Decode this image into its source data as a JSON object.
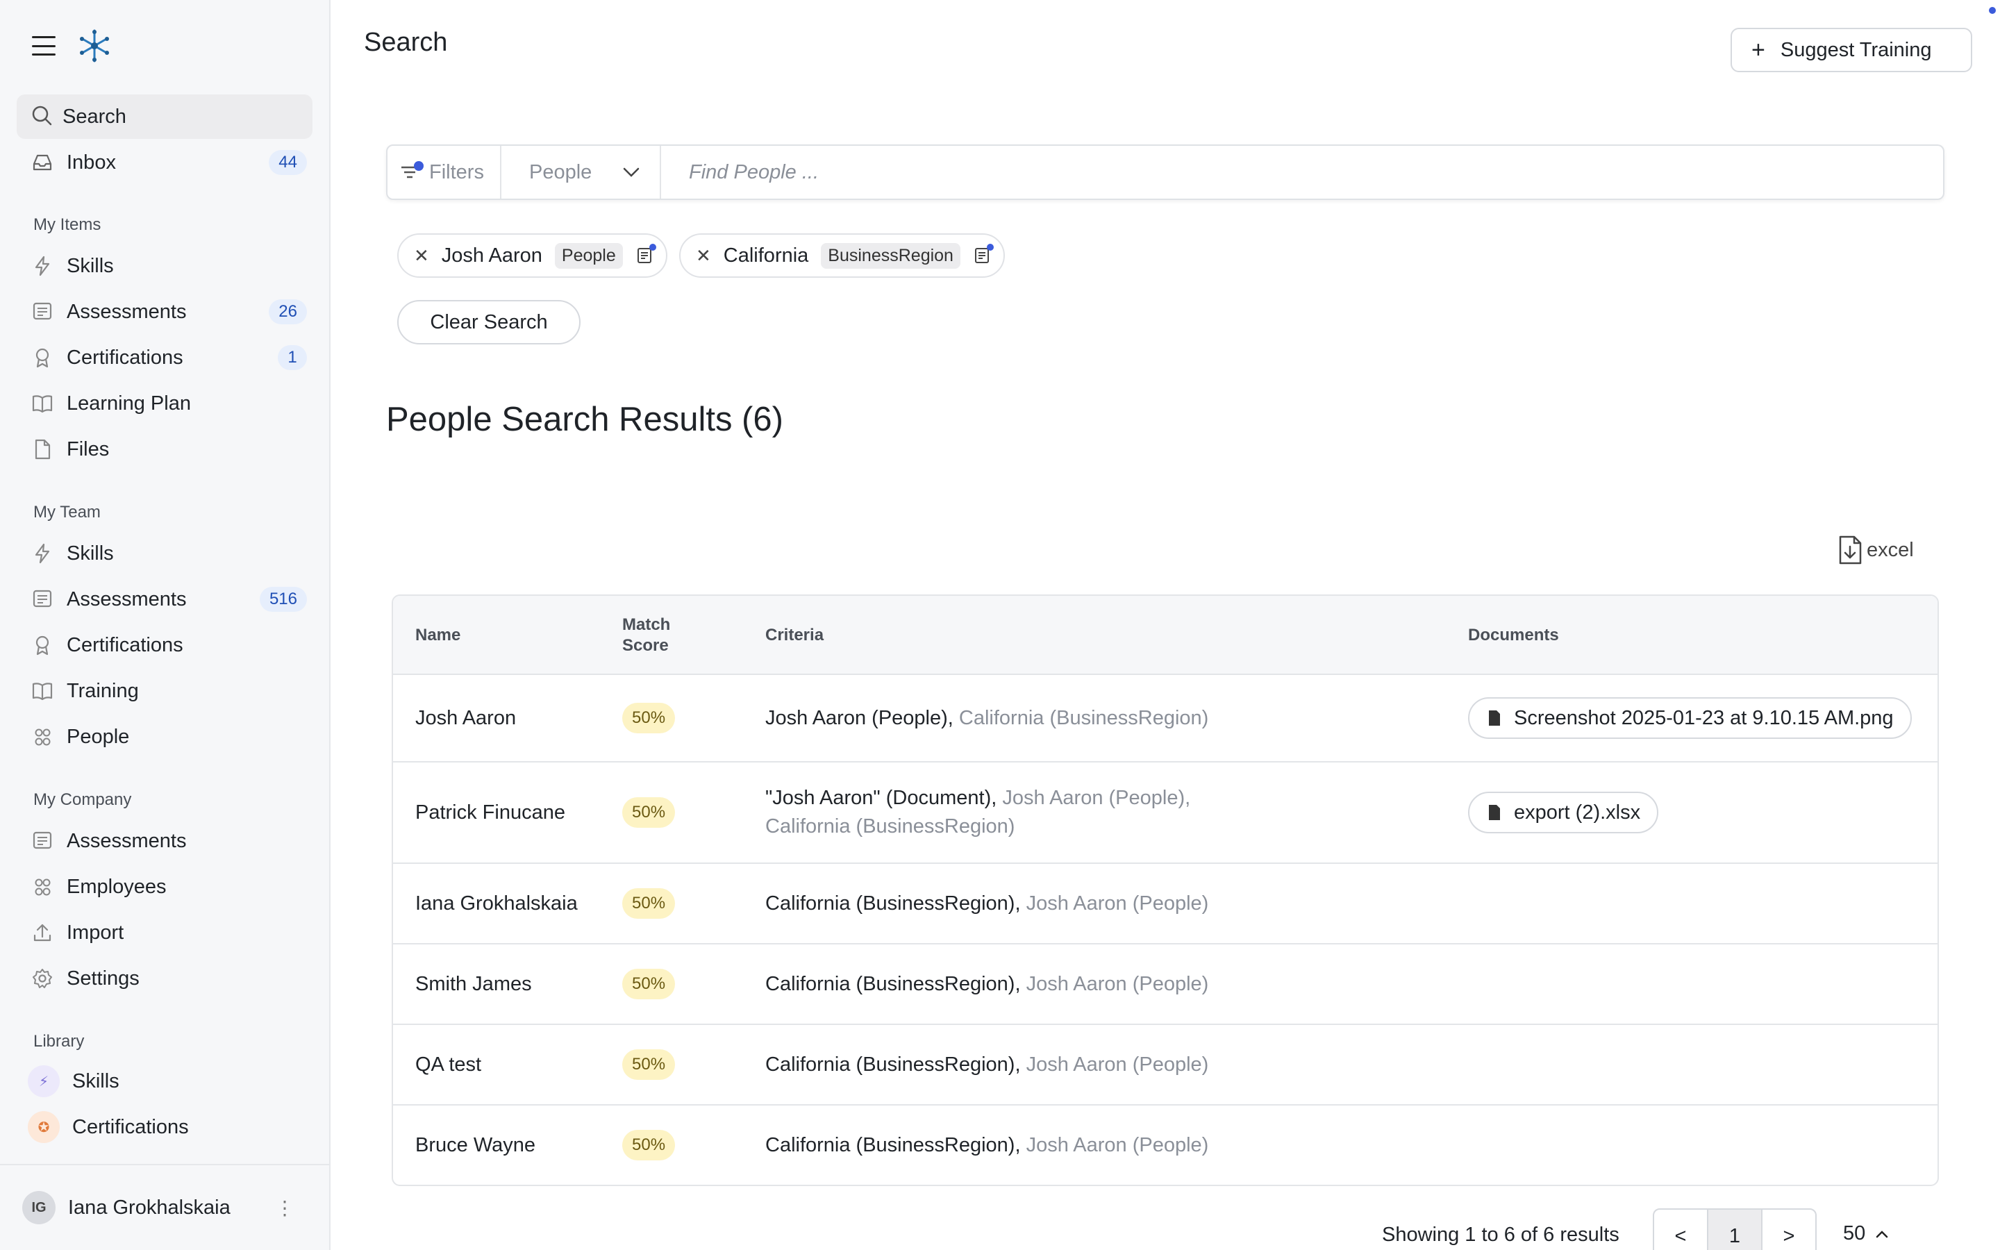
{
  "sidebar": {
    "search_label": "Search",
    "inbox_label": "Inbox",
    "inbox_count": "44",
    "sections": {
      "my_items": "My Items",
      "my_team": "My Team",
      "my_company": "My Company",
      "library": "Library"
    },
    "my_items": [
      {
        "label": "Skills",
        "icon": "bolt-icon"
      },
      {
        "label": "Assessments",
        "icon": "assessment-icon",
        "badge": "26"
      },
      {
        "label": "Certifications",
        "icon": "award-icon",
        "badge": "1"
      },
      {
        "label": "Learning Plan",
        "icon": "book-icon"
      },
      {
        "label": "Files",
        "icon": "file-icon"
      }
    ],
    "my_team": [
      {
        "label": "Skills",
        "icon": "bolt-icon"
      },
      {
        "label": "Assessments",
        "icon": "assessment-icon",
        "badge": "516"
      },
      {
        "label": "Certifications",
        "icon": "award-icon"
      },
      {
        "label": "Training",
        "icon": "book-icon"
      },
      {
        "label": "People",
        "icon": "people-icon"
      }
    ],
    "my_company": [
      {
        "label": "Assessments",
        "icon": "assessment-icon"
      },
      {
        "label": "Employees",
        "icon": "people-icon"
      },
      {
        "label": "Import",
        "icon": "upload-icon"
      },
      {
        "label": "Settings",
        "icon": "gear-icon"
      }
    ],
    "library": [
      {
        "label": "Skills",
        "icon": "bolt-icon",
        "color": "#ece9fb"
      },
      {
        "label": "Certifications",
        "icon": "award-icon",
        "color": "#fde8d9"
      }
    ],
    "user": {
      "initials": "IG",
      "name": "Iana Grokhalskaia"
    }
  },
  "header": {
    "title": "Search",
    "suggest_button": "Suggest Training"
  },
  "searchbar": {
    "filters_label": "Filters",
    "type_value": "People",
    "placeholder": "Find People ..."
  },
  "chips": [
    {
      "value": "Josh Aaron",
      "tag": "People"
    },
    {
      "value": "California",
      "tag": "BusinessRegion"
    }
  ],
  "clear_search": "Clear Search",
  "results": {
    "title": "People Search Results (6)",
    "excel_label": "excel",
    "columns": {
      "name": "Name",
      "match_score_1": "Match",
      "match_score_2": "Score",
      "criteria": "Criteria",
      "documents": "Documents"
    },
    "rows": [
      {
        "name": "Josh Aaron",
        "score": "50%",
        "criteria_primary": "Josh Aaron (People),",
        "criteria_secondary": "California (BusinessRegion)",
        "document": "Screenshot 2025-01-23 at 9.10.15 AM.png"
      },
      {
        "name": "Patrick Finucane",
        "score": "50%",
        "criteria_primary": "\"Josh Aaron\" (Document),",
        "criteria_secondary": "Josh Aaron (People),",
        "criteria_tertiary": "California (BusinessRegion)",
        "document": "export (2).xlsx"
      },
      {
        "name": "Iana Grokhalskaia",
        "score": "50%",
        "criteria_primary": "California (BusinessRegion),",
        "criteria_secondary": "Josh Aaron (People)"
      },
      {
        "name": "Smith James",
        "score": "50%",
        "criteria_primary": "California (BusinessRegion),",
        "criteria_secondary": "Josh Aaron (People)"
      },
      {
        "name": "QA test",
        "score": "50%",
        "criteria_primary": "California (BusinessRegion),",
        "criteria_secondary": "Josh Aaron (People)"
      },
      {
        "name": "Bruce Wayne",
        "score": "50%",
        "criteria_primary": "California (BusinessRegion),",
        "criteria_secondary": "Josh Aaron (People)"
      }
    ]
  },
  "pagination": {
    "summary": "Showing 1 to 6 of 6 results",
    "prev": "<",
    "page": "1",
    "next": ">",
    "page_size": "50"
  },
  "colors": {
    "accent": "#3b5bdb",
    "score_bg": "#fdf3c4"
  }
}
